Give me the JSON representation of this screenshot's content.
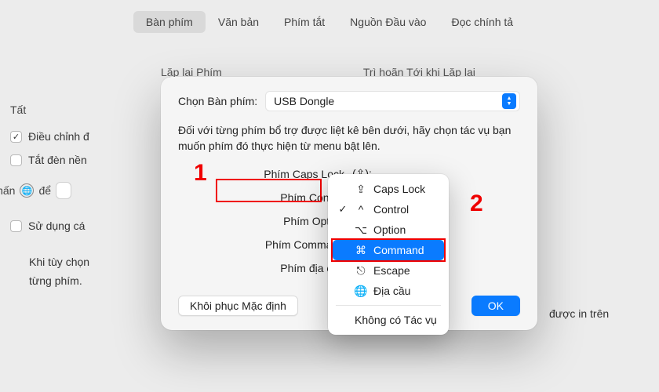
{
  "tabs": {
    "items": [
      {
        "label": "Bàn phím",
        "selected": true
      },
      {
        "label": "Văn bản",
        "selected": false
      },
      {
        "label": "Phím tắt",
        "selected": false
      },
      {
        "label": "Nguồn Đầu vào",
        "selected": false
      },
      {
        "label": "Đọc chính tả",
        "selected": false
      }
    ]
  },
  "background": {
    "repeat_label": "Lặp lại Phím",
    "delay_label": "Trì hoãn Tới khi Lặp lại",
    "tat_prefix": "Tất",
    "adjust_label": "Điều chỉnh đ",
    "backlight_label": "Tắt đèn nền",
    "press_label_pre": "Nhấn",
    "press_label_post": "để",
    "use_label": "Sử dụng cá",
    "truncated1": "Khi tùy chọn",
    "truncated_right": "được in trên",
    "truncated2": "từng phím."
  },
  "sheet": {
    "select_label": "Chọn Bàn phím:",
    "select_value": "USB Dongle",
    "description": "Đối với từng phím bổ trợ được liệt kê bên dưới, hãy chọn tác vụ bạn muốn phím đó thực hiện từ menu bật lên.",
    "keys": [
      {
        "label": "Phím Caps Lock",
        "symbol": "(⇪):"
      },
      {
        "label": "Phím Control",
        "symbol": "(^):"
      },
      {
        "label": "Phím Option",
        "symbol": "(⌥):"
      },
      {
        "label": "Phím Command",
        "symbol": "(⌘):"
      },
      {
        "label": "Phím địa cầu",
        "symbol": "(🌐):"
      }
    ],
    "restore_label": "Khôi phục Mặc định",
    "ok_label": "OK"
  },
  "popup": {
    "items": [
      {
        "symbol": "⇪",
        "label": "Caps Lock",
        "checked": false,
        "selected": false
      },
      {
        "symbol": "^",
        "label": "Control",
        "checked": true,
        "selected": false
      },
      {
        "symbol": "⌥",
        "label": "Option",
        "checked": false,
        "selected": false
      },
      {
        "symbol": "⌘",
        "label": "Command",
        "checked": false,
        "selected": true
      },
      {
        "symbol": "⎋",
        "label": "Escape",
        "checked": false,
        "selected": false
      },
      {
        "symbol": "🌐",
        "label": "Địa cầu",
        "checked": false,
        "selected": false
      }
    ],
    "none_label": "Không có Tác vụ"
  },
  "annotations": {
    "n1": "1",
    "n2": "2"
  }
}
